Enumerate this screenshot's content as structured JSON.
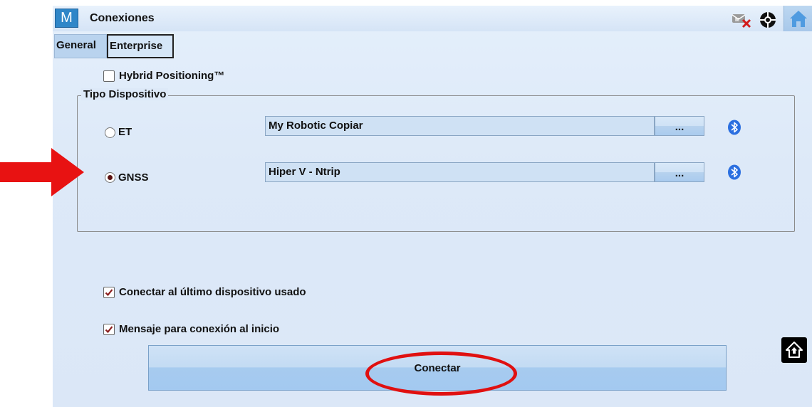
{
  "window": {
    "logo_letter": "M",
    "title": "Conexiones"
  },
  "tabs": [
    {
      "label": "General",
      "active": true
    },
    {
      "label": "Enterprise",
      "active": false
    }
  ],
  "hybrid": {
    "label": "Hybrid Positioning™",
    "checked": false
  },
  "device_group": {
    "legend": "Tipo Dispositivo",
    "options": [
      {
        "label": "ET",
        "selected": false,
        "device": "My Robotic Copiar",
        "browse_label": "..."
      },
      {
        "label": "GNSS",
        "selected": true,
        "device": "Hiper V - Ntrip",
        "browse_label": "..."
      }
    ]
  },
  "options": {
    "connect_last": {
      "label": "Conectar al último dispositivo usado",
      "checked": true
    },
    "startup_message": {
      "label": "Mensaje para conexión al inicio",
      "checked": true
    }
  },
  "connect_button": {
    "label": "Conectar"
  },
  "colors": {
    "accent": "#2f86c8",
    "annotation_red": "#e01010",
    "bluetooth": "#2b6fe0"
  },
  "icons": [
    "m-logo-icon",
    "mail-error-icon",
    "globe-icon",
    "home-icon",
    "bluetooth-icon",
    "side-home-icon",
    "red-arrow",
    "red-ellipse"
  ]
}
